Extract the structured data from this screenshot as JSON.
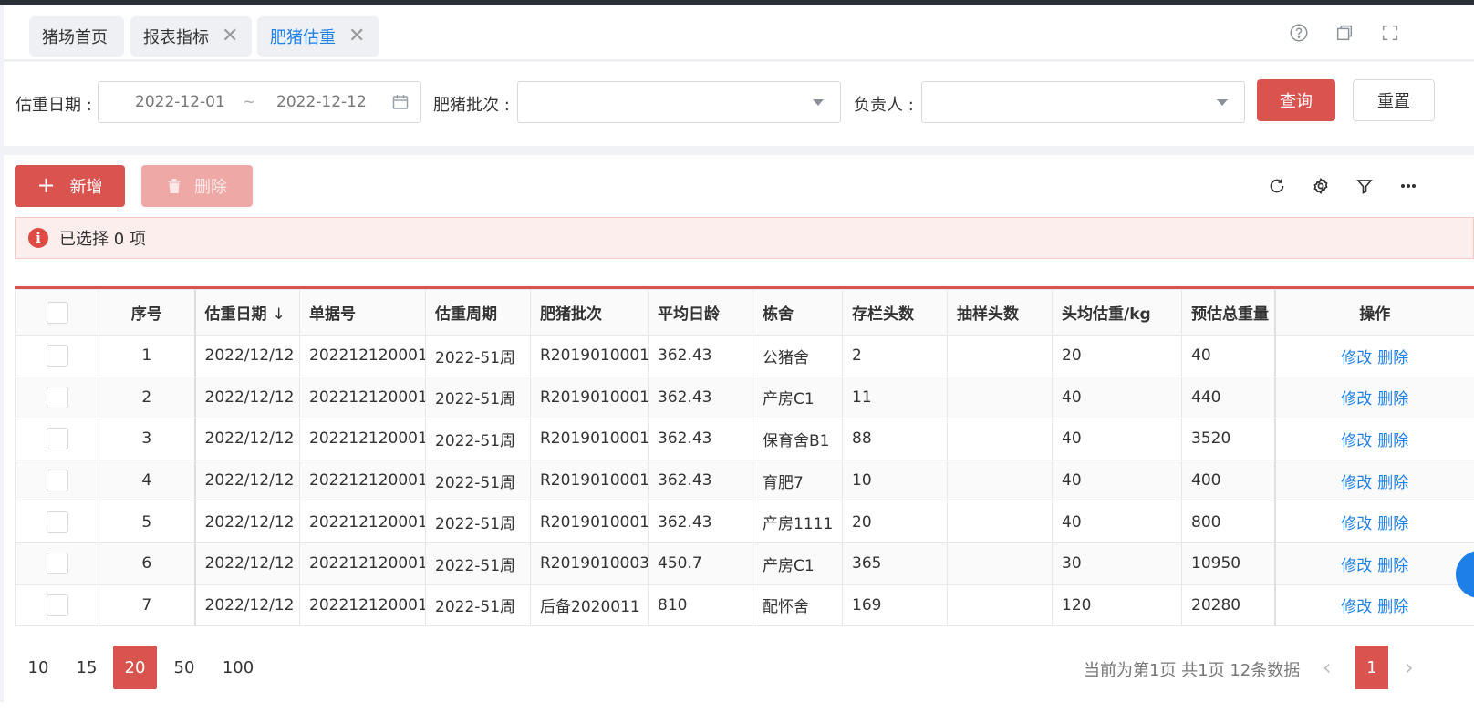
{
  "tabs": [
    {
      "label": "猪场首页",
      "closable": false
    },
    {
      "label": "报表指标",
      "closable": true
    },
    {
      "label": "肥猪估重",
      "closable": true,
      "active": true
    }
  ],
  "tab_close_glyph": "✕",
  "header_icons": [
    "help-icon",
    "restore-window-icon",
    "fullscreen-icon"
  ],
  "filters": {
    "date_label": "估重日期 :",
    "date_start": "2022-12-01",
    "date_sep": "~",
    "date_end": "2022-12-12",
    "batch_label": "肥猪批次 :",
    "batch_value": "",
    "owner_label": "负责人 :",
    "owner_value": "",
    "query_label": "查询",
    "reset_label": "重置"
  },
  "toolbar": {
    "add_label": "新增",
    "add_icon": "+",
    "delete_label": "删除",
    "icons": [
      "refresh-icon",
      "settings-icon",
      "filter-icon",
      "more-icon"
    ]
  },
  "alert": {
    "text": "已选择 0 项",
    "icon_glyph": "i"
  },
  "table": {
    "columns": [
      "序号",
      "估重日期",
      "单据号",
      "估重周期",
      "肥猪批次",
      "平均日龄",
      "栋舍",
      "存栏头数",
      "抽样头数",
      "头均估重/kg",
      "预估总重量",
      "操作"
    ],
    "sort_arrow": "↓",
    "rows": [
      {
        "seq": "1",
        "date": "2022/12/12",
        "doc": "202212120001",
        "period": "2022-51周",
        "batch": "R2019010001",
        "age": "362.43",
        "house": "公猪舍",
        "stock": "2",
        "sample": "",
        "avg": "20",
        "total": "40"
      },
      {
        "seq": "2",
        "date": "2022/12/12",
        "doc": "202212120001",
        "period": "2022-51周",
        "batch": "R2019010001",
        "age": "362.43",
        "house": "产房C1",
        "stock": "11",
        "sample": "",
        "avg": "40",
        "total": "440"
      },
      {
        "seq": "3",
        "date": "2022/12/12",
        "doc": "202212120001",
        "period": "2022-51周",
        "batch": "R2019010001",
        "age": "362.43",
        "house": "保育舍B1",
        "stock": "88",
        "sample": "",
        "avg": "40",
        "total": "3520"
      },
      {
        "seq": "4",
        "date": "2022/12/12",
        "doc": "202212120001",
        "period": "2022-51周",
        "batch": "R2019010001",
        "age": "362.43",
        "house": "育肥7",
        "stock": "10",
        "sample": "",
        "avg": "40",
        "total": "400"
      },
      {
        "seq": "5",
        "date": "2022/12/12",
        "doc": "202212120001",
        "period": "2022-51周",
        "batch": "R2019010001",
        "age": "362.43",
        "house": "产房1111",
        "stock": "20",
        "sample": "",
        "avg": "40",
        "total": "800"
      },
      {
        "seq": "6",
        "date": "2022/12/12",
        "doc": "202212120001",
        "period": "2022-51周",
        "batch": "R2019010003",
        "age": "450.7",
        "house": "产房C1",
        "stock": "365",
        "sample": "",
        "avg": "30",
        "total": "10950"
      },
      {
        "seq": "7",
        "date": "2022/12/12",
        "doc": "202212120001",
        "period": "2022-51周",
        "batch": "后备2020011",
        "age": "810",
        "house": "配怀舍",
        "stock": "169",
        "sample": "",
        "avg": "120",
        "total": "20280"
      }
    ],
    "edit_label": "修改",
    "delete_label": "删除"
  },
  "pagination": {
    "sizes": [
      "10",
      "15",
      "20",
      "50",
      "100"
    ],
    "active_size": "20",
    "info": "当前为第1页 共1页 12条数据",
    "prev_glyph": "‹",
    "next_glyph": "›",
    "current_page": "1"
  },
  "colors": {
    "primary": "#d9534f",
    "link": "#1f7fe8",
    "alert_bg": "#fdeeee"
  }
}
